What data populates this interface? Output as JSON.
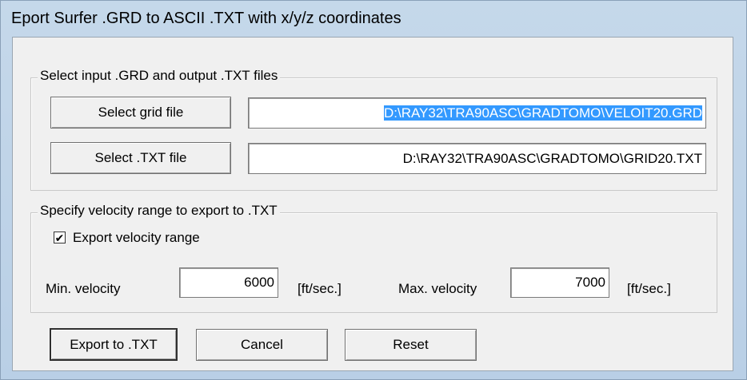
{
  "window": {
    "title": "Eport Surfer .GRD to ASCII .TXT with x/y/z coordinates"
  },
  "files_group": {
    "legend": "Select input .GRD and output .TXT files",
    "grid_button": "Select grid file",
    "grid_path": "D:\\RAY32\\TRA90ASC\\GRADTOMO\\VELOIT20.GRD",
    "txt_button": "Select .TXT file",
    "txt_path": "D:\\RAY32\\TRA90ASC\\GRADTOMO\\GRID20.TXT"
  },
  "velocity_group": {
    "legend": "Specify velocity range to export to .TXT",
    "checkbox_label": "Export velocity range",
    "checkbox_checked": true,
    "min_label": "Min. velocity",
    "min_value": "6000",
    "min_unit": "[ft/sec.]",
    "max_label": "Max. velocity",
    "max_value": "7000",
    "max_unit": "[ft/sec.]"
  },
  "buttons": {
    "export": "Export to .TXT",
    "cancel": "Cancel",
    "reset": "Reset"
  },
  "colors": {
    "selection": "#3399ff",
    "titlebar": "#c5d8ea"
  }
}
